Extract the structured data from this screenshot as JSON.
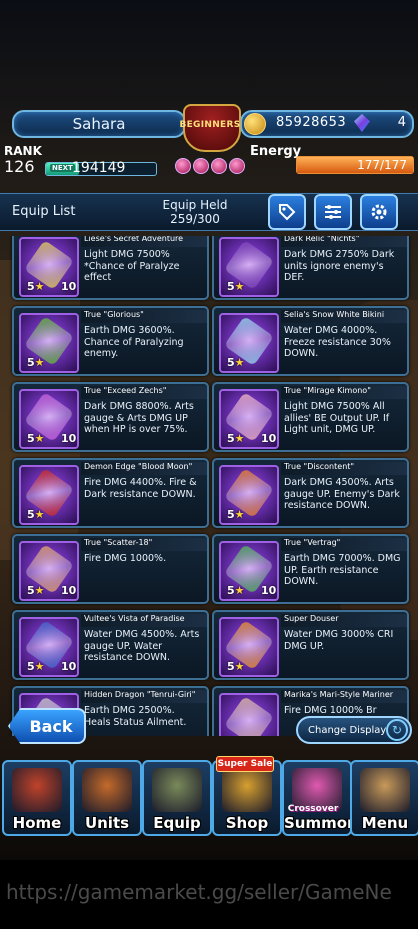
{
  "player": {
    "name": "Sahara",
    "rank_label": "RANK",
    "rank": "126",
    "next_label": "NEXT",
    "exp_to_next": "194149",
    "exp_progress": 0.3,
    "emblem_text": "BEGINNERS"
  },
  "currency": {
    "coins": "85928653",
    "gems": "4"
  },
  "energy": {
    "label": "Energy",
    "value": "177/177",
    "fraction": 1.0
  },
  "list_header": {
    "title": "Equip List",
    "held_label": "Equip Held",
    "held_value": "259/300",
    "buttons": [
      "tag-icon",
      "filter-sort-icon",
      "gear-icon"
    ]
  },
  "equipment": [
    {
      "name": "Liese's Secret Adventure",
      "desc": "Light DMG 7500% *Chance of Paralyze effect",
      "stars": "5",
      "level": "10",
      "color": "#d9c25a"
    },
    {
      "name": "Dark Relic \"Nichts\"",
      "desc": "Dark DMG 2750% Dark units ignore enemy's DEF.",
      "stars": "5",
      "level": "",
      "color": "#7b3fb8"
    },
    {
      "name": "True \"Glorious\"",
      "desc": "Earth DMG 3600%. Chance of Paralyzing enemy.",
      "stars": "5",
      "level": "",
      "color": "#5fae3a"
    },
    {
      "name": "Selia's Snow White Bikini",
      "desc": "Water DMG 4000%. Freeze resistance 30% DOWN.",
      "stars": "5",
      "level": "",
      "color": "#8fcbe8"
    },
    {
      "name": "True \"Exceed Zechs\"",
      "desc": "Dark DMG 8800%. Arts gauge & Arts DMG UP when HP is over 75%.",
      "stars": "5",
      "level": "10",
      "color": "#c05ad8"
    },
    {
      "name": "True \"Mirage Kimono\"",
      "desc": "Light DMG 7500% All allies' BE Output UP. If Light unit, DMG UP.",
      "stars": "5",
      "level": "10",
      "color": "#e6a8c0"
    },
    {
      "name": "Demon Edge \"Blood Moon\"",
      "desc": "Fire DMG 4400%. Fire & Dark resistance DOWN.",
      "stars": "5",
      "level": "",
      "color": "#c62626"
    },
    {
      "name": "True \"Discontent\"",
      "desc": "Dark DMG 4500%. Arts gauge UP. Enemy's Dark resistance DOWN.",
      "stars": "5",
      "level": "",
      "color": "#e07a30"
    },
    {
      "name": "True \"Scatter-18\"",
      "desc": "Fire DMG 1000%.",
      "stars": "5",
      "level": "10",
      "color": "#d89a6a"
    },
    {
      "name": "True \"Vertrag\"",
      "desc": "Earth DMG 7000%. DMG UP. Earth resistance DOWN.",
      "stars": "5",
      "level": "10",
      "color": "#4fae5a"
    },
    {
      "name": "Vultee's Vista of Paradise",
      "desc": "Water DMG 4500%. Arts gauge UP. Water resistance DOWN.",
      "stars": "5",
      "level": "10",
      "color": "#4060c8"
    },
    {
      "name": "Super Douser",
      "desc": "Water DMG 3000% CRI DMG UP.",
      "stars": "5",
      "level": "",
      "color": "#e08a30"
    },
    {
      "name": "Hidden Dragon \"Tenrui-Giri\"",
      "desc": "Earth DMG 2500%. Heals Status Ailment.",
      "stars": "",
      "level": "",
      "color": "#c0c0c0"
    },
    {
      "name": "Marika's Mari-Style Mariner",
      "desc": "Fire DMG 1000% Br",
      "stars": "",
      "level": "",
      "color": "#d8b0a0"
    }
  ],
  "controls": {
    "back_label": "Back",
    "change_display_label": "Change Display"
  },
  "nav": [
    {
      "label": "Home",
      "icon": "home-icon",
      "color": "#c0432a"
    },
    {
      "label": "Units",
      "icon": "units-icon",
      "color": "#c46a2a"
    },
    {
      "label": "Equip",
      "icon": "equip-icon",
      "color": "#7a8a5a"
    },
    {
      "label": "Shop",
      "icon": "shop-icon",
      "color": "#d8a030"
    },
    {
      "label": "Summon",
      "icon": "summon-icon",
      "color": "#e05ab0"
    },
    {
      "label": "Menu",
      "icon": "menu-book-icon",
      "color": "#c89a5a"
    }
  ],
  "nav_badges": {
    "super_sale": "Super Sale",
    "crossover": "Crossover"
  },
  "watermark": "https://gamemarket.gg/seller/GameNe"
}
